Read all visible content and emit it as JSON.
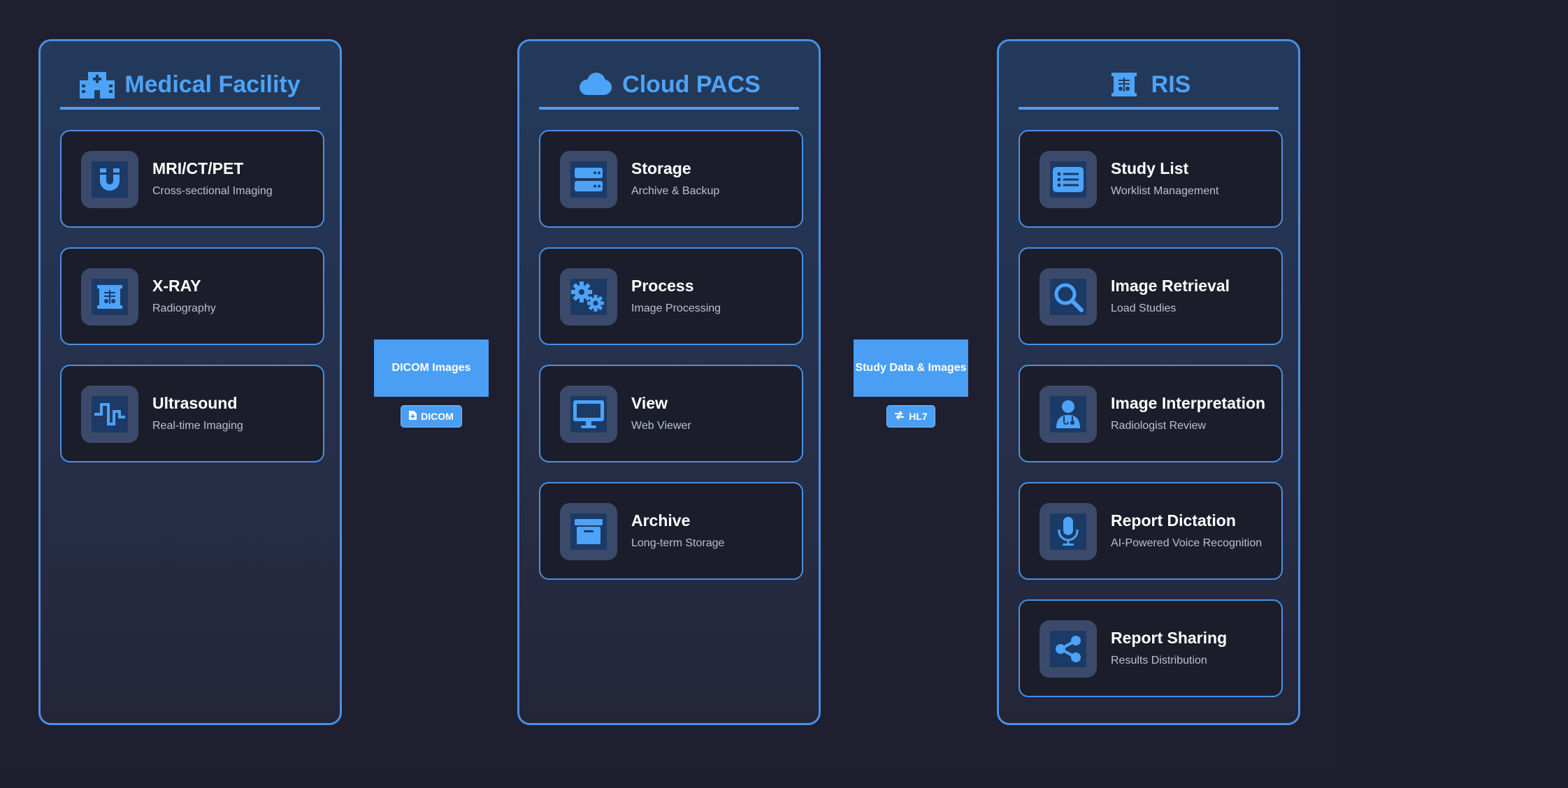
{
  "colors": {
    "accent": "#4a9ff5",
    "title": "#4da3f7",
    "background": "#1e1e2c",
    "card": "#1c1d2b"
  },
  "panels": [
    {
      "title": "Medical Facility",
      "icon": "hospital-icon",
      "cards": [
        {
          "title": "MRI/CT/PET",
          "subtitle": "Cross-sectional Imaging",
          "icon": "magnet-icon"
        },
        {
          "title": "X-RAY",
          "subtitle": "Radiography",
          "icon": "x-ray-icon"
        },
        {
          "title": "Ultrasound",
          "subtitle": "Real-time Imaging",
          "icon": "wave-square-icon"
        }
      ]
    },
    {
      "title": "Cloud PACS",
      "icon": "cloud-icon",
      "cards": [
        {
          "title": "Storage",
          "subtitle": "Archive & Backup",
          "icon": "server-icon"
        },
        {
          "title": "Process",
          "subtitle": "Image Processing",
          "icon": "cogs-icon"
        },
        {
          "title": "View",
          "subtitle": "Web Viewer",
          "icon": "desktop-icon"
        },
        {
          "title": "Archive",
          "subtitle": "Long-term Storage",
          "icon": "archive-icon"
        }
      ]
    },
    {
      "title": "RIS",
      "icon": "x-ray-icon",
      "cards": [
        {
          "title": "Study List",
          "subtitle": "Worklist Management",
          "icon": "list-icon"
        },
        {
          "title": "Image Retrieval",
          "subtitle": "Load Studies",
          "icon": "search-icon"
        },
        {
          "title": "Image Interpretation",
          "subtitle": "Radiologist Review",
          "icon": "user-doctor-icon"
        },
        {
          "title": "Report Dictation",
          "subtitle": "AI-Powered Voice Recognition",
          "icon": "microphone-icon"
        },
        {
          "title": "Report Sharing",
          "subtitle": "Results Distribution",
          "icon": "share-icon"
        }
      ]
    }
  ],
  "connectors": [
    {
      "label": "DICOM Images",
      "badge": "DICOM",
      "badge_icon": "file-medical-icon"
    },
    {
      "label": "Study Data & Images",
      "badge": "HL7",
      "badge_icon": "exchange-icon"
    }
  ]
}
